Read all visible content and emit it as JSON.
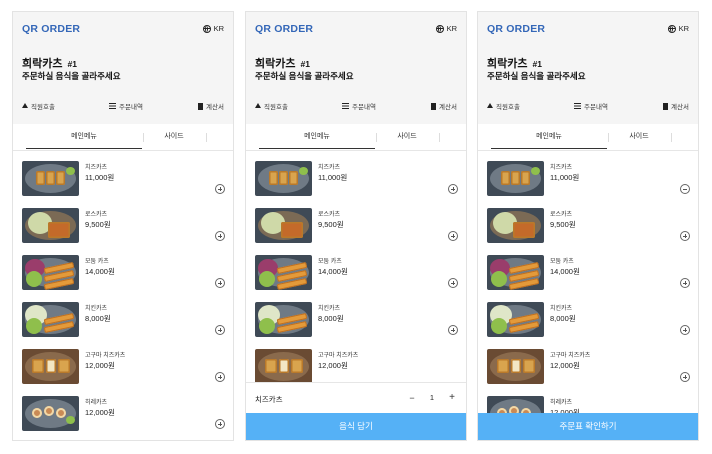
{
  "brand": "QR ORDER",
  "lang": "KR",
  "store": {
    "name": "희락카츠",
    "table": "#1"
  },
  "prompt": "주문하실 음식을 골라주세요",
  "actions": {
    "call": "직원호출",
    "history": "주문내역",
    "bill": "계산서"
  },
  "tabs": {
    "main": "메인메뉴",
    "side": "사이드"
  },
  "menu": [
    {
      "name": "치즈카츠",
      "price": "11,000원",
      "photo": "cheese-katsu"
    },
    {
      "name": "로스카츠",
      "price": "9,500원",
      "photo": "rosu-katsu"
    },
    {
      "name": "모둠 카츠",
      "price": "14,000원",
      "photo": "mixed-katsu"
    },
    {
      "name": "치킨카츠",
      "price": "8,000원",
      "photo": "chicken-katsu"
    },
    {
      "name": "고구마 치즈카츠",
      "price": "12,000원",
      "photo": "sweet-potato-cheese-katsu"
    },
    {
      "name": "히레카츠",
      "price": "12,000원",
      "photo": "hire-katsu"
    }
  ],
  "cart": {
    "item": "치즈카츠",
    "qty": "1",
    "minus": "−",
    "plus": "+"
  },
  "buttons": {
    "add": "음식 담기",
    "confirm": "주문표 확인하기"
  },
  "colors": {
    "brand": "#3467b8",
    "cta": "#55b1f6",
    "header_bg": "#f5f5f5"
  }
}
